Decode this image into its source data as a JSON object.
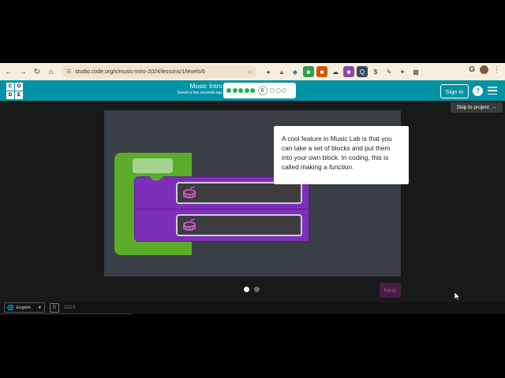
{
  "browser": {
    "url": "studio.code.org/s/music-intro-2024/lessons/1/levels/6",
    "extensions": [
      "mic-icon",
      "megaphone-icon",
      "fish-icon",
      "green-ext-icon",
      "red-ext-icon",
      "cloud-ext-icon",
      "purple-ext-icon",
      "q-ext-icon",
      "dollar-ext-icon",
      "pen-ext-icon",
      "wand-ext-icon",
      "puzzle-icon"
    ],
    "g_label": "G"
  },
  "header": {
    "logo_letters": [
      "C",
      "O",
      "D",
      "E"
    ],
    "title": "Music Intro",
    "saved_status": "Saved a few seconds ago",
    "progress": {
      "completed": 5,
      "current": "6",
      "remaining": 3
    },
    "sign_in": "Sign in",
    "help": "?"
  },
  "skip_to_project": "Skip to project",
  "tooltip": {
    "text_before": "A cool feature in Music Lab is that you can take a set of blocks and put them into your own block. In coding, this is called making a ",
    "text_emphasis": "function",
    "text_after": "."
  },
  "pagination": {
    "total": 2,
    "active": 0
  },
  "next_button": "Next",
  "footer": {
    "language": "English",
    "year": "2024"
  },
  "colors": {
    "header": "#0093a4",
    "function_block": "#5aac29",
    "sound_block": "#7c2fb8",
    "panel": "#3a3e45"
  }
}
